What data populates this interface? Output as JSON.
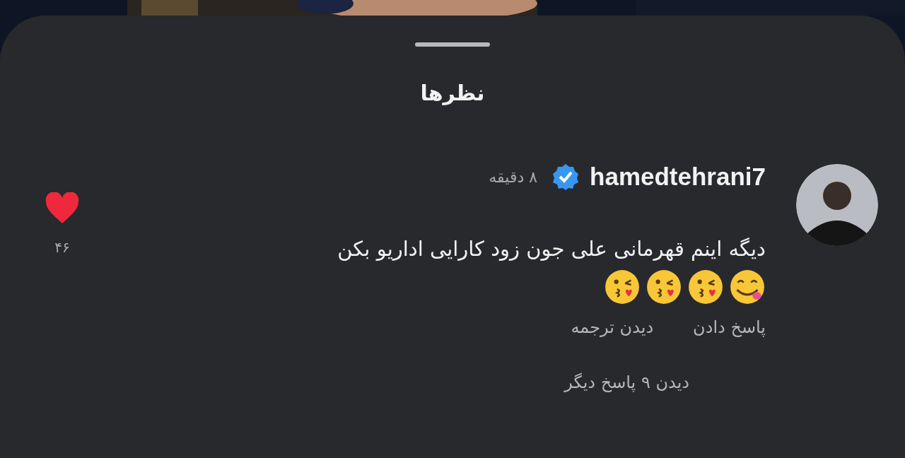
{
  "sheet": {
    "title": "نظرها"
  },
  "comment": {
    "username": "hamedtehrani7",
    "verified": true,
    "time": "۸ دقیقه",
    "text": "دیگه اینم قهرمانی علی جون زود کارایی اداریو بکن",
    "emojis": [
      {
        "kind": "savoring"
      },
      {
        "kind": "kiss"
      },
      {
        "kind": "kiss"
      },
      {
        "kind": "kiss"
      }
    ],
    "actions": [
      "پاسخ دادن",
      "دیدن ترجمه"
    ],
    "liked": true,
    "like_count": "۴۶",
    "more_replies": "دیدن ۹ پاسخ دیگر"
  }
}
